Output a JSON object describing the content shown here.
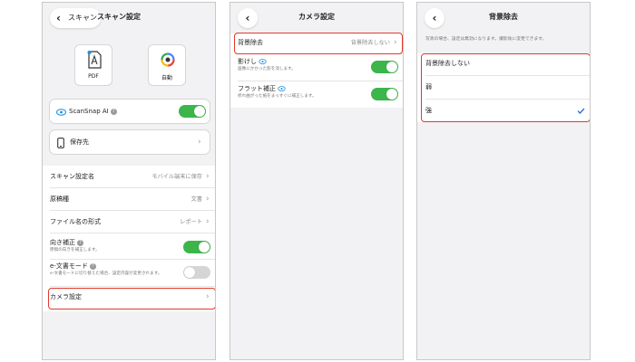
{
  "screen1": {
    "back_label": "スキャン",
    "title": "スキャン設定",
    "mode_pdf_label": "PDF",
    "mode_auto_label": "自動",
    "scansnap_ai_label": "ScanSnap AI",
    "scansnap_ai_on": true,
    "save_dest_label": "保存先",
    "rows": [
      {
        "label": "スキャン設定名",
        "value": "モバイル端末に保存"
      },
      {
        "label": "原稿種",
        "value": "文書"
      },
      {
        "label": "ファイル名の形式",
        "value": "レポート"
      }
    ],
    "orientation": {
      "label": "向き補正",
      "sub": "原稿の向きを補正します。",
      "on": true
    },
    "edoc": {
      "label": "e-文書モード",
      "sub": "e-文書モードに切り替えた場合、設定内容が変更されます。",
      "on": false
    },
    "camera_label": "カメラ設定"
  },
  "screen2": {
    "title": "カメラ設定",
    "bg_removal_label": "背景除去",
    "bg_removal_value": "背景除去しない",
    "shadow": {
      "label": "影けし",
      "sub": "画像にかかった影を消します。",
      "on": true
    },
    "flat": {
      "label": "フラット補正",
      "sub": "折れ曲がった紙をまっすぐに補正します。",
      "on": true
    }
  },
  "screen3": {
    "title": "背景除去",
    "note": "写真の場合、設定は無効になります。撮影後に変更できます。",
    "options": [
      "背景除去しない",
      "弱",
      "強"
    ],
    "selected_index": 2
  },
  "colors": {
    "toggle_on": "#3cb54a",
    "highlight": "#e23a2c",
    "check": "#1a73e8"
  }
}
